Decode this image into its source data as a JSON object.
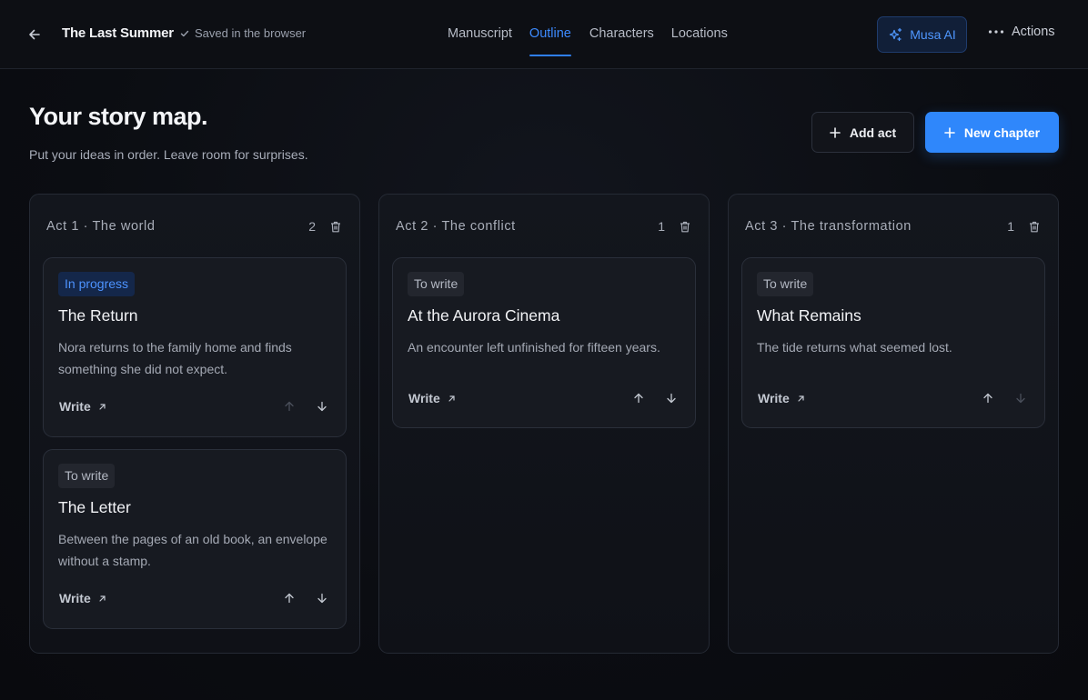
{
  "header": {
    "back_icon": "arrow-left-icon",
    "book_title": "The Last Summer",
    "saved_status": "Saved in the browser",
    "tabs": [
      {
        "label": "Manuscript",
        "active": false
      },
      {
        "label": "Outline",
        "active": true
      },
      {
        "label": "Characters",
        "active": false
      },
      {
        "label": "Locations",
        "active": false
      }
    ],
    "ai_button": "Musa AI",
    "actions_label": "Actions"
  },
  "page": {
    "title": "Your story map.",
    "subtitle": "Put your ideas in order. Leave room for surprises.",
    "add_act_label": "Add act",
    "new_chapter_label": "New chapter"
  },
  "colors": {
    "accent": "#2f87fb",
    "progress_badge_text": "#4d93ff",
    "background": "#0b0d12"
  },
  "acts": [
    {
      "title": "Act 1 · The world",
      "count": "2",
      "chapters": [
        {
          "status": "In progress",
          "status_type": "progress",
          "title": "The Return",
          "description": "Nora returns to the family home and finds something she did not expect.",
          "write_label": "Write",
          "up_disabled": true,
          "down_disabled": false
        },
        {
          "status": "To write",
          "status_type": "towrite",
          "title": "The Letter",
          "description": "Between the pages of an old book, an envelope without a stamp.",
          "write_label": "Write",
          "up_disabled": false,
          "down_disabled": false
        }
      ]
    },
    {
      "title": "Act 2 · The conflict",
      "count": "1",
      "chapters": [
        {
          "status": "To write",
          "status_type": "towrite",
          "title": "At the Aurora Cinema",
          "description": "An encounter left unfinished for fifteen years.",
          "write_label": "Write",
          "up_disabled": false,
          "down_disabled": false
        }
      ]
    },
    {
      "title": "Act 3 · The transformation",
      "count": "1",
      "chapters": [
        {
          "status": "To write",
          "status_type": "towrite",
          "title": "What Remains",
          "description": "The tide returns what seemed lost.",
          "write_label": "Write",
          "up_disabled": false,
          "down_disabled": true
        }
      ]
    }
  ]
}
